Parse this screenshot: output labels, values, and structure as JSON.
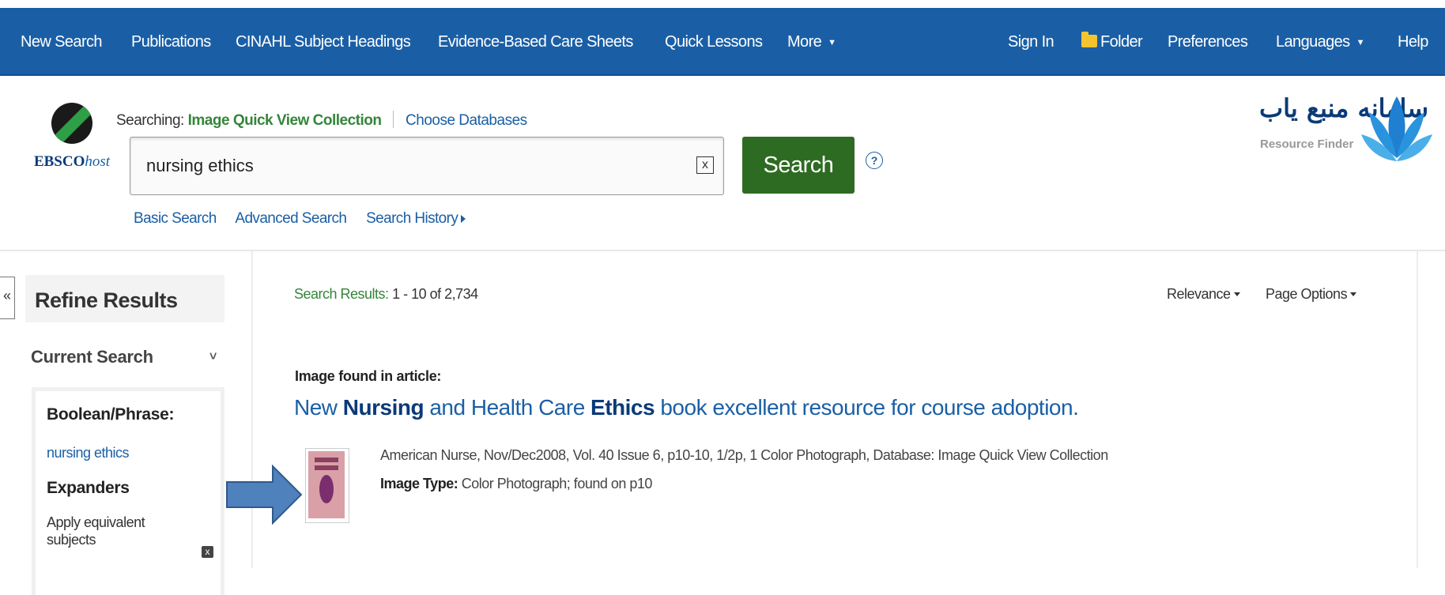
{
  "topnav": {
    "items": [
      "New Search",
      "Publications",
      "CINAHL Subject Headings",
      "Evidence-Based Care Sheets",
      "Quick Lessons",
      "More"
    ],
    "right_items": [
      "Sign In",
      "Folder",
      "Preferences",
      "Languages",
      "Help"
    ]
  },
  "logo": {
    "brand": "EBSCO",
    "brand_suffix": "host"
  },
  "search": {
    "searching_prefix": "Searching:",
    "database": "Image Quick View Collection",
    "choose_databases": "Choose Databases",
    "query": "nursing ethics",
    "clear_label": "x",
    "button_label": "Search",
    "help_label": "?",
    "links": [
      "Basic Search",
      "Advanced Search",
      "Search History"
    ]
  },
  "resource_finder": {
    "persian": "سامانه منبع یاب",
    "english": "Resource Finder"
  },
  "sidebar": {
    "collapse_label": "«",
    "title": "Refine Results",
    "current_search": "Current Search",
    "boolean_label": "Boolean/Phrase:",
    "boolean_term": "nursing ethics",
    "expanders_label": "Expanders",
    "expander_item": "Apply equivalent subjects",
    "remove_label": "x"
  },
  "results": {
    "count_label": "Search Results:",
    "count_value": "1 - 10 of 2,734",
    "sort_label": "Relevance",
    "page_options_label": "Page Options",
    "items": [
      {
        "found_label": "Image found in article:",
        "title_parts": [
          "New ",
          "Nursing",
          " and Health Care ",
          "Ethics",
          " book excellent resource for course adoption."
        ],
        "meta": "American Nurse, Nov/Dec2008, Vol. 40 Issue 6, p10-10, 1/2p, 1 Color Photograph, Database: Image Quick View Collection",
        "image_type_label": "Image Type:",
        "image_type_value": "Color Photograph; found on p10"
      }
    ]
  },
  "colors": {
    "nav_blue": "#1a5fa6",
    "search_green": "#2e6b22",
    "database_green": "#35853a",
    "arrow_blue": "#4f81bd",
    "link_blue": "#1a5fa6"
  }
}
